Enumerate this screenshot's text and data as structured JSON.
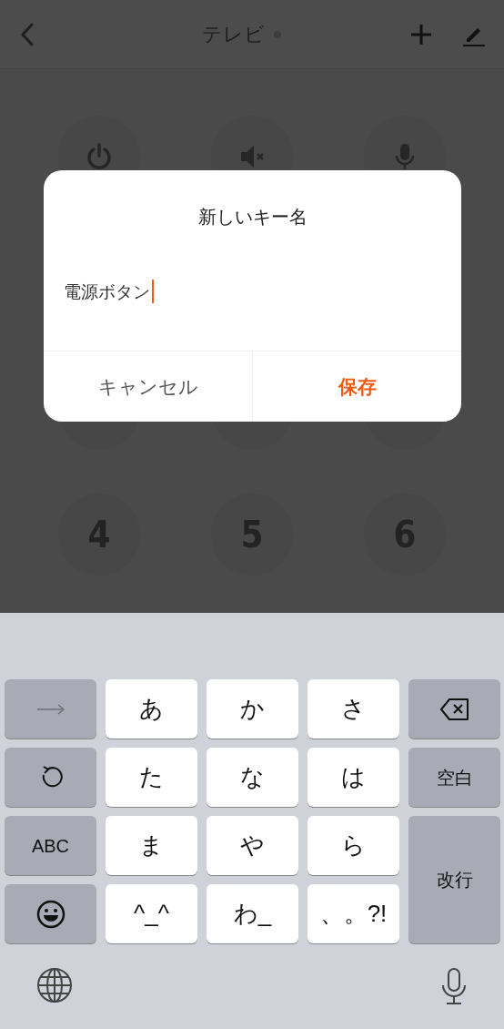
{
  "header": {
    "title": "テレビ",
    "connected": false
  },
  "remote": {
    "rows": [
      [
        {
          "kind": "power"
        },
        {
          "kind": "mute"
        },
        {
          "kind": "mic"
        }
      ],
      [
        {
          "kind": "blank"
        },
        {
          "kind": "blank"
        },
        {
          "kind": "blank"
        }
      ],
      [
        {
          "kind": "digit",
          "label": "4"
        },
        {
          "kind": "digit",
          "label": "5"
        },
        {
          "kind": "digit",
          "label": "6"
        }
      ]
    ]
  },
  "dialog": {
    "title": "新しいキー名",
    "input": {
      "value": "電源ボタン",
      "focused": true
    },
    "buttons": [
      {
        "label": "キャンセル",
        "kind": "cancel"
      },
      {
        "label": "保存",
        "kind": "primary"
      }
    ]
  },
  "keyboard": {
    "left_keys": [
      {
        "kind": "arrow",
        "disabled": true
      },
      {
        "kind": "undo"
      },
      {
        "kind": "text",
        "label": "ABC"
      },
      {
        "kind": "emoji"
      }
    ],
    "letter_keys": [
      "あ",
      "か",
      "さ",
      "た",
      "な",
      "は",
      "ま",
      "や",
      "ら",
      "^_^",
      "わ_",
      "、。?!"
    ],
    "right_keys": [
      {
        "kind": "delete"
      },
      {
        "kind": "text",
        "label": "空白"
      },
      {
        "kind": "text",
        "label": "改行"
      }
    ]
  }
}
